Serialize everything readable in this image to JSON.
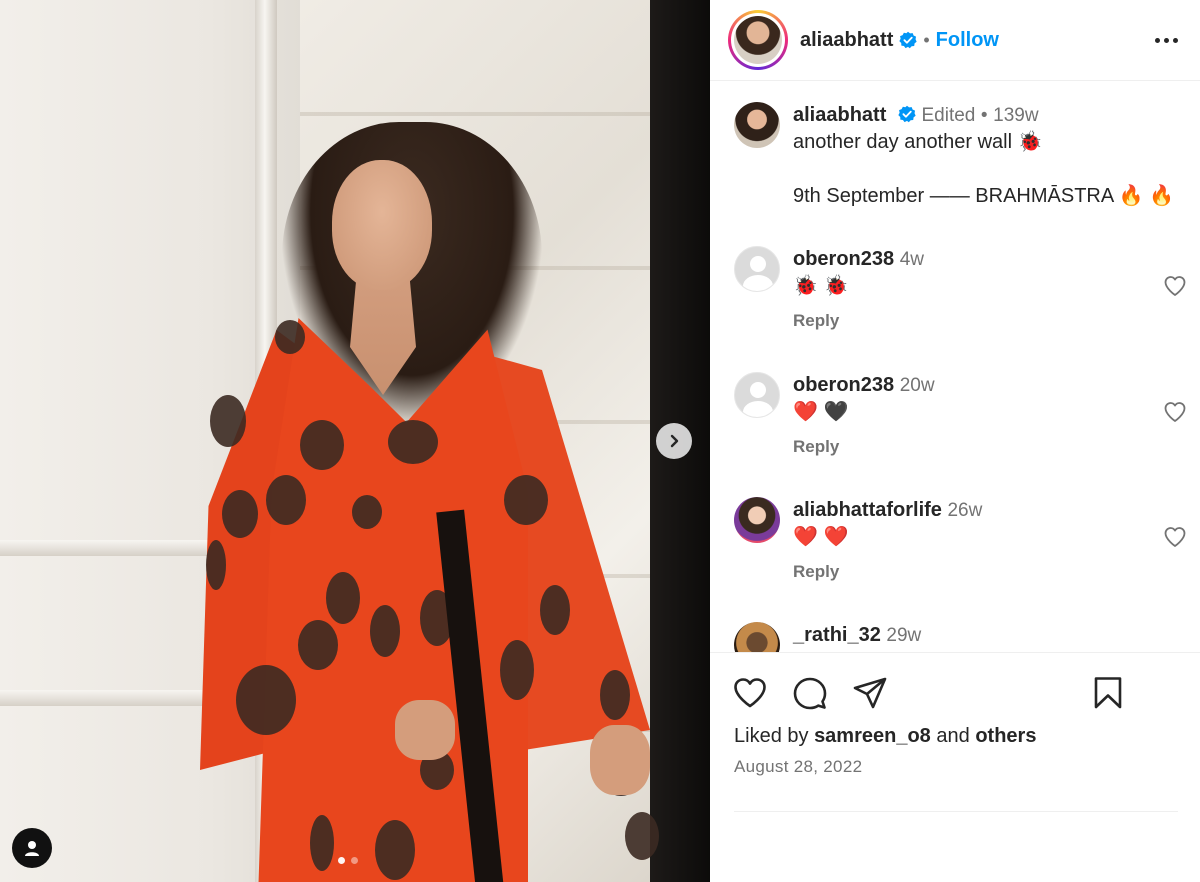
{
  "post": {
    "author": "aliaabhatt",
    "follow_label": "Follow",
    "separator": "•"
  },
  "caption": {
    "username": "aliaabhatt",
    "edited": "Edited",
    "age": "139w",
    "line1": "another day another wall 🐞",
    "line2": "9th September —— BRAHMĀSTRA 🔥 🔥"
  },
  "comments": [
    {
      "username": "oberon238",
      "age": "4w",
      "text": "🐞 🐞",
      "reply": "Reply"
    },
    {
      "username": "oberon238",
      "age": "20w",
      "text": "❤️ 🖤",
      "reply": "Reply"
    },
    {
      "username": "aliabhattaforlife",
      "age": "26w",
      "text": "❤️ ❤️",
      "reply": "Reply"
    },
    {
      "username": "_rathi_32",
      "age": "29w"
    }
  ],
  "likes": {
    "prefix": "Liked by",
    "user": "samreen_o8",
    "middle": "and",
    "suffix": "others"
  },
  "date": "August 28, 2022",
  "carousel": {
    "count": 2,
    "active_index": 0
  },
  "colors": {
    "accent": "#0095f6",
    "text": "#262626",
    "muted": "#737373"
  }
}
